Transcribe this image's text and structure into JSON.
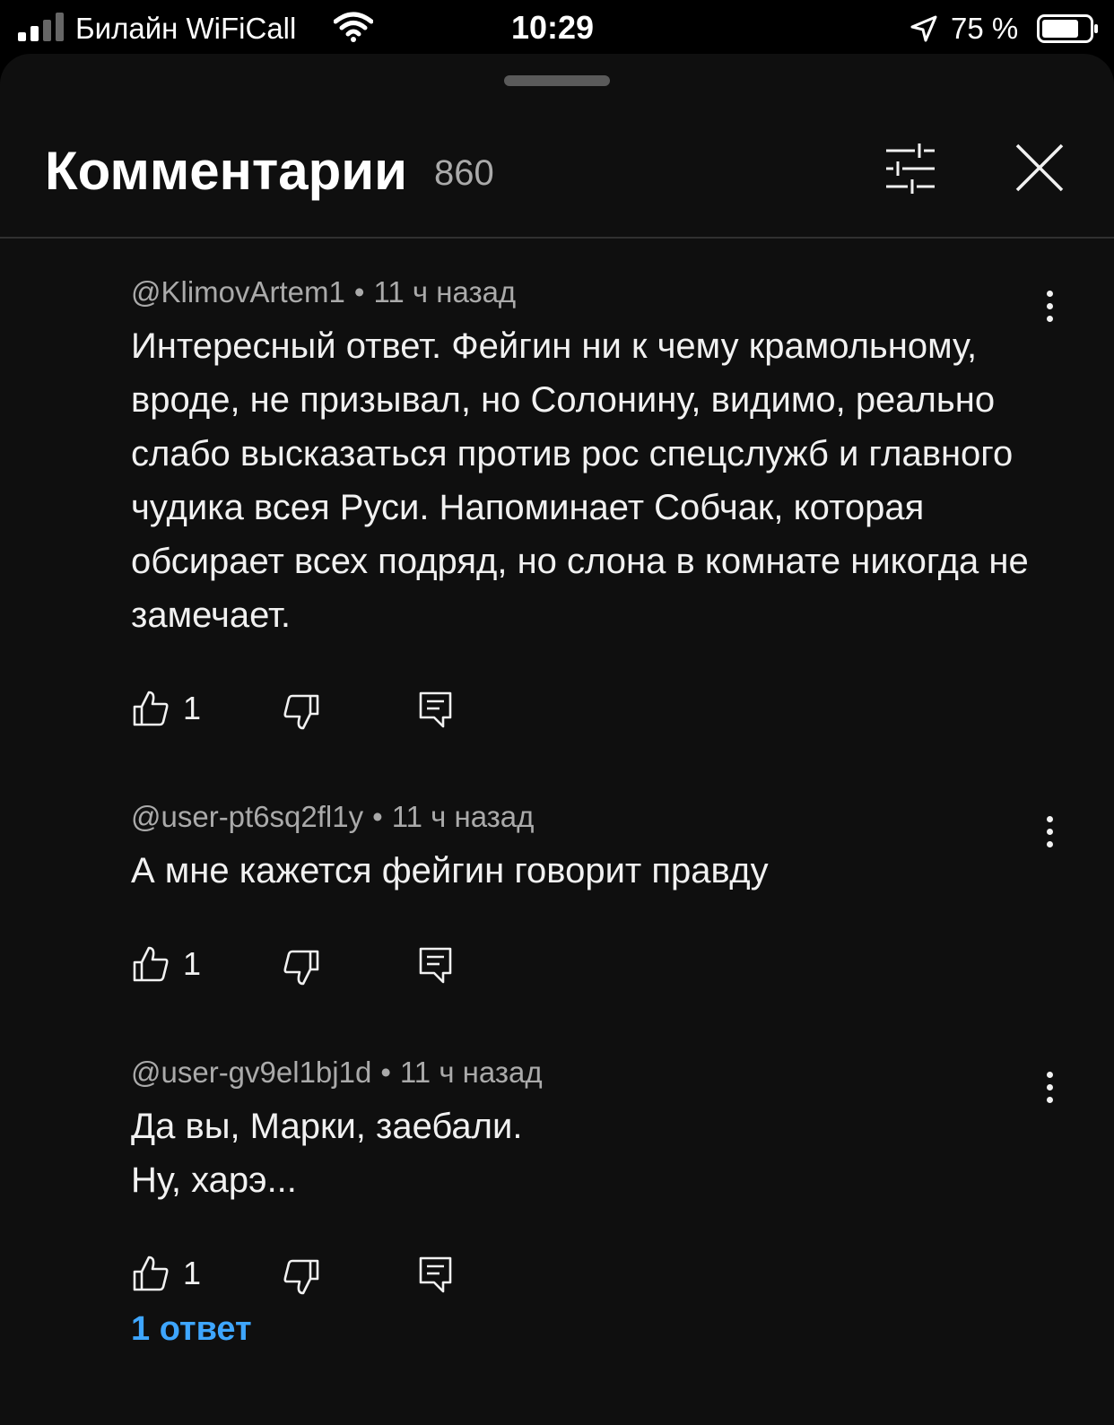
{
  "status_bar": {
    "carrier": "Билайн WiFiCall",
    "time": "10:29",
    "battery_percent": "75 %"
  },
  "header": {
    "title": "Комментарии",
    "count": "860"
  },
  "comments": [
    {
      "author": "@KlimovArtem1",
      "separator": "•",
      "time": "11 ч назад",
      "text": "Интересный ответ. Фейгин ни к чему крамольному, вроде, не призывал, но Солонину, видимо, реально слабо высказаться против рос спецслужб и главного чудика всея Руси. Напоминает Собчак, которая обсирает всех подряд, но слона в комнате никогда не замечает.",
      "likes": "1"
    },
    {
      "author": "@user-pt6sq2fl1y",
      "separator": "•",
      "time": "11 ч назад",
      "text": "А мне кажется фейгин говорит правду",
      "likes": "1"
    },
    {
      "author": "@user-gv9el1bj1d",
      "separator": "•",
      "time": "11 ч назад",
      "text_lines": [
        "Да вы, Марки, заебали.",
        "Ну, харэ..."
      ],
      "likes": "1",
      "replies_label": "1 ответ"
    }
  ],
  "colors": {
    "background": "#0f0f0f",
    "text": "#f1f1f1",
    "secondary_text": "#aaaaaa",
    "link": "#3ea6ff"
  },
  "icons": [
    "signal-icon",
    "wifi-icon",
    "location-arrow-icon",
    "battery-icon",
    "filter-sliders-icon",
    "close-icon",
    "thumb-up-icon",
    "thumb-down-icon",
    "reply-icon",
    "more-vertical-icon"
  ]
}
